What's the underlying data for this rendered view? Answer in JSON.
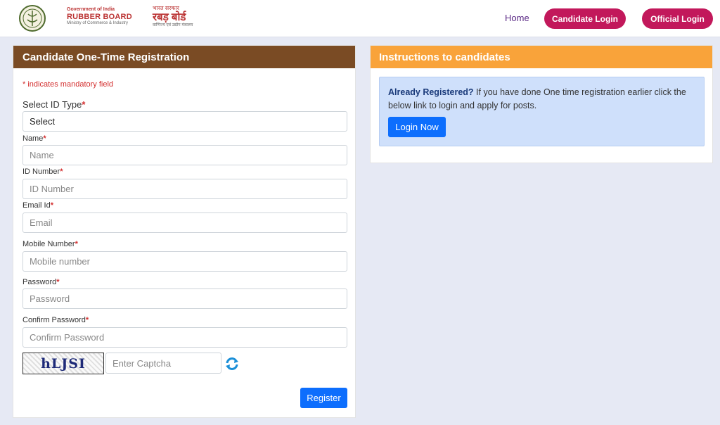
{
  "header": {
    "org_en": {
      "line1": "Government of India",
      "line2": "RUBBER BOARD",
      "line3": "Ministry of Commerce & Industry"
    },
    "org_hi": {
      "line1": "भारत सरकार",
      "line2": "रबड़ बोर्ड",
      "line3": "वाणिज्य एवं उद्योग मंत्रालय"
    },
    "nav": {
      "home": "Home",
      "candidate_login": "Candidate Login",
      "official_login": "Official Login"
    }
  },
  "registration": {
    "title": "Candidate One-Time Registration",
    "mandatory_note": "* indicates mandatory field",
    "required_mark": "*",
    "fields": {
      "id_type": {
        "label": "Select ID Type",
        "value": "Select"
      },
      "name": {
        "label": "Name",
        "placeholder": "Name"
      },
      "id_number": {
        "label": "ID Number",
        "placeholder": "ID Number"
      },
      "email": {
        "label": "Email Id",
        "placeholder": "Email"
      },
      "mobile": {
        "label": "Mobile Number",
        "placeholder": "Mobile number"
      },
      "password": {
        "label": "Password",
        "placeholder": "Password"
      },
      "confirm_password": {
        "label": "Confirm Password",
        "placeholder": "Confirm Password"
      }
    },
    "captcha": {
      "text": "hLJSI",
      "placeholder": "Enter Captcha"
    },
    "register_button": "Register"
  },
  "instructions": {
    "title": "Instructions to candidates",
    "already_registered": "Already Registered?",
    "message": " If you have done One time registration earlier click the below link to login and apply for posts.",
    "login_button": "Login Now"
  },
  "colors": {
    "registration_header": "#7a4b24",
    "instructions_header": "#f9a33a",
    "nav_pill": "#c2185b",
    "primary_button": "#0d6efd"
  }
}
